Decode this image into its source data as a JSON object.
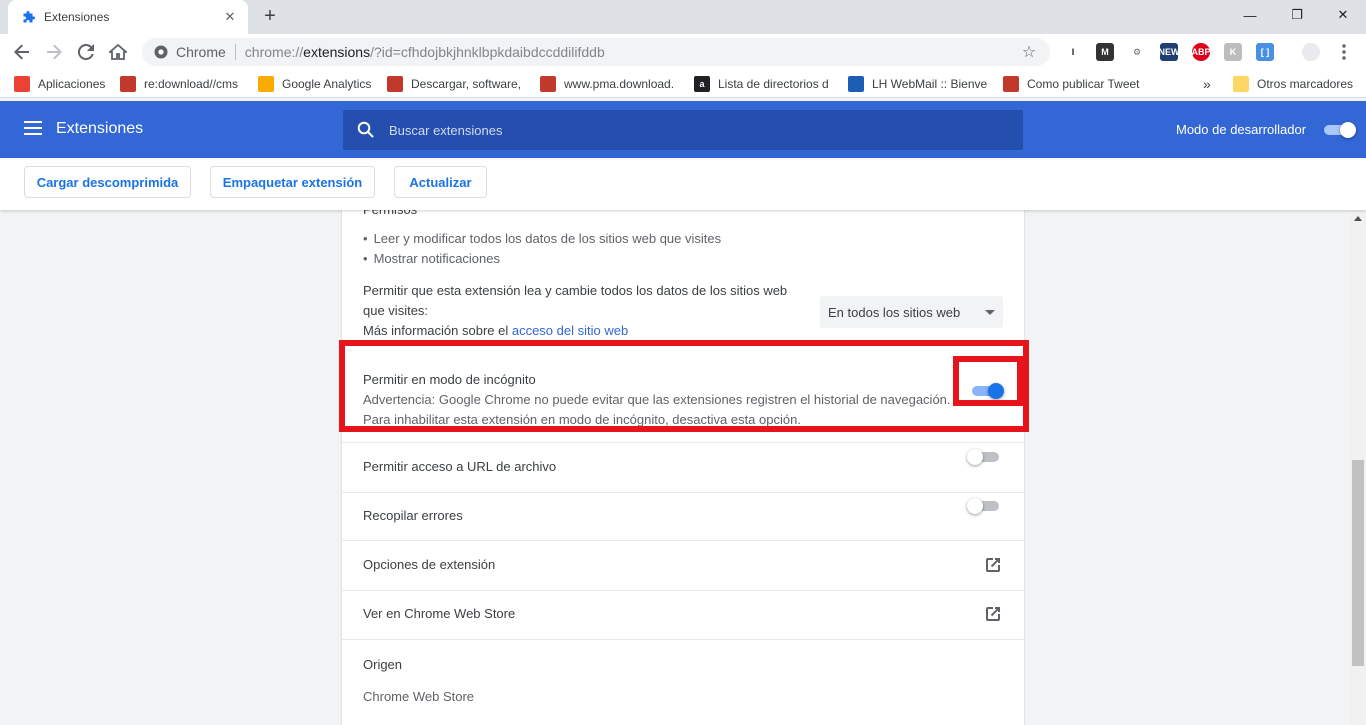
{
  "browser": {
    "tab_title": "Extensiones",
    "tab_close": "✕",
    "new_tab": "+",
    "window_controls": {
      "minimize": "—",
      "maximize": "❐",
      "close": "✕"
    },
    "site_chip": "Chrome",
    "url_prefix": "chrome://",
    "url_host": "extensions",
    "url_rest": "/?id=cfhdojbkjhnklbpkdaibdccddilifddb",
    "extension_icons": [
      {
        "name": "i-icon",
        "glyph": "I",
        "bg": "#ffffff",
        "color": "#202124"
      },
      {
        "name": "m-icon",
        "glyph": "M",
        "bg": "#333333",
        "color": "#ffffff"
      },
      {
        "name": "settings-ext-icon",
        "glyph": "⚙",
        "bg": "#ffffff",
        "color": "#5f6368"
      },
      {
        "name": "news-icon",
        "glyph": "NEW",
        "bg": "#1f3f73",
        "color": "#ffffff"
      },
      {
        "name": "adblock-icon",
        "glyph": "ABP",
        "bg": "#e1001a",
        "color": "#ffffff"
      },
      {
        "name": "k-icon",
        "glyph": "K",
        "bg": "#bdbdbd",
        "color": "#ffffff"
      },
      {
        "name": "bracket-icon",
        "glyph": "[ ]",
        "bg": "#4a90e2",
        "color": "#ffffff"
      },
      {
        "name": "profile-icon",
        "glyph": "",
        "bg": "#e8eaed",
        "color": "#5f6368"
      }
    ]
  },
  "bookmarks": {
    "items": [
      {
        "label": "Aplicaciones",
        "color": "#ea4335",
        "glyph": ""
      },
      {
        "label": "re:download//cms",
        "color": "#c0392b",
        "glyph": ""
      },
      {
        "label": "Google Analytics",
        "color": "#f9ab00",
        "glyph": ""
      },
      {
        "label": "Descargar, software, ",
        "color": "#c0392b",
        "glyph": ""
      },
      {
        "label": "www.pma.download.",
        "color": "#c0392b",
        "glyph": ""
      },
      {
        "label": "Lista de directorios d",
        "color": "#202124",
        "glyph": "a"
      },
      {
        "label": "LH WebMail :: Bienve",
        "color": "#1a5fb4",
        "glyph": ""
      },
      {
        "label": "Como publicar Tweet",
        "color": "#c0392b",
        "glyph": ""
      }
    ],
    "overflow": "»",
    "other": "Otros marcadores"
  },
  "header": {
    "title": "Extensiones",
    "search_placeholder": "Buscar extensiones",
    "devmode_label": "Modo de desarrollador",
    "devmode_on": true
  },
  "actions": {
    "load_unpacked": "Cargar descomprimida",
    "pack": "Empaquetar extensión",
    "update": "Actualizar"
  },
  "details": {
    "permissions_heading": "Permisos",
    "permissions": [
      "Leer y modificar todos los datos de los sitios web que visites",
      "Mostrar notificaciones"
    ],
    "site_access_line1": "Permitir que esta extensión lea y cambie todos los datos de los sitios web",
    "site_access_line2": "que visites:",
    "site_access_more": "Más información sobre el ",
    "site_access_link": "acceso del sitio web",
    "site_access_value": "En todos los sitios web",
    "incognito_title": "Permitir en modo de incógnito",
    "incognito_warning1": "Advertencia: Google Chrome no puede evitar que las extensiones registren el historial de navegación.",
    "incognito_warning2": "Para inhabilitar esta extensión en modo de incógnito, desactiva esta opción.",
    "incognito_on": true,
    "file_url_label": "Permitir acceso a URL de archivo",
    "file_url_on": false,
    "errors_label": "Recopilar errores",
    "errors_on": false,
    "options_label": "Opciones de extensión",
    "store_label": "Ver en Chrome Web Store",
    "source_heading": "Origen",
    "source_value": "Chrome Web Store"
  },
  "colors": {
    "header_blue": "#3367d6",
    "search_bg": "#254fae",
    "accent": "#1a73e8",
    "highlight_red": "#e8141c"
  }
}
